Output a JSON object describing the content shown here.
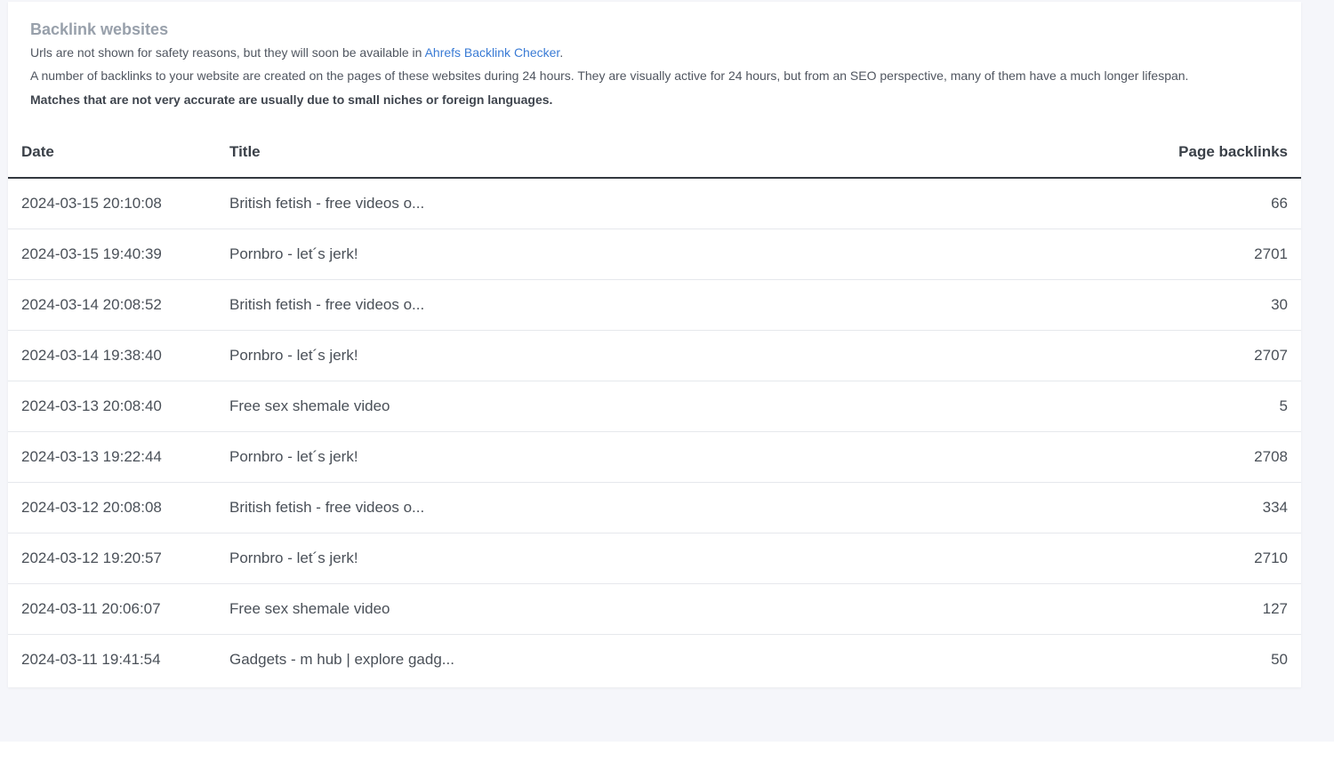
{
  "card": {
    "title": "Backlink websites",
    "info_prefix": "Urls are not shown for safety reasons, but they will soon be available in ",
    "info_link": "Ahrefs Backlink Checker",
    "info_suffix": ".",
    "description": "A number of backlinks to your website are created on the pages of these websites during 24 hours. They are visually active for 24 hours, but from an SEO perspective, many of them have a much longer lifespan.",
    "note": "Matches that are not very accurate are usually due to small niches or foreign languages."
  },
  "table": {
    "headers": {
      "date": "Date",
      "title": "Title",
      "backlinks": "Page backlinks"
    },
    "rows": [
      {
        "date": "2024-03-15 20:10:08",
        "title": "British fetish - free videos o...",
        "backlinks": "66"
      },
      {
        "date": "2024-03-15 19:40:39",
        "title": "Pornbro - let´s jerk!",
        "backlinks": "2701"
      },
      {
        "date": "2024-03-14 20:08:52",
        "title": "British fetish - free videos o...",
        "backlinks": "30"
      },
      {
        "date": "2024-03-14 19:38:40",
        "title": "Pornbro - let´s jerk!",
        "backlinks": "2707"
      },
      {
        "date": "2024-03-13 20:08:40",
        "title": "Free sex shemale video",
        "backlinks": "5"
      },
      {
        "date": "2024-03-13 19:22:44",
        "title": "Pornbro - let´s jerk!",
        "backlinks": "2708"
      },
      {
        "date": "2024-03-12 20:08:08",
        "title": "British fetish - free videos o...",
        "backlinks": "334"
      },
      {
        "date": "2024-03-12 19:20:57",
        "title": "Pornbro - let´s jerk!",
        "backlinks": "2710"
      },
      {
        "date": "2024-03-11 20:06:07",
        "title": "Free sex shemale video",
        "backlinks": "127"
      },
      {
        "date": "2024-03-11 19:41:54",
        "title": "Gadgets - m hub | explore gadg...",
        "backlinks": "50"
      }
    ]
  },
  "colors": {
    "page_background": "#f5f6fa",
    "card_background": "#ffffff",
    "title_color": "#98a0ab",
    "link_color": "#3a7bd5"
  }
}
